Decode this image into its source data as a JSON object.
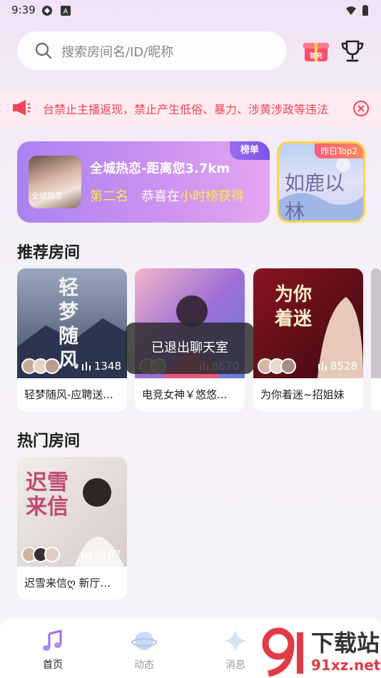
{
  "status_bar": {
    "time": "9:39"
  },
  "search": {
    "placeholder": "搜索房间名/ID/昵称"
  },
  "header_icons": {
    "recharge_label": "首充"
  },
  "notice": {
    "text": "台禁止主播返现，禁止产生低俗、暴力、涉黄涉政等违法"
  },
  "rank_banner": {
    "title": "全城热恋-距离您3.7km",
    "rank_text": "第二名",
    "congrats_prefix": "恭喜在",
    "highlight": "小时榜获得",
    "tag": "榜单",
    "avatar_caption": "全城热恋"
  },
  "top2": {
    "tag": "昨日Top2",
    "art_text": "如鹿以林"
  },
  "sections": {
    "recommended": "推荐房间",
    "hot": "热门房间"
  },
  "recommended_rooms": [
    {
      "name": "轻梦随风-应聘送...",
      "count": "1348",
      "cover_text": "轻梦随风"
    },
    {
      "name": "电竞女神￥悠悠...",
      "count": "8670",
      "cover_text": ""
    },
    {
      "name": "为你着迷~招姐妹",
      "count": "8528",
      "cover_text": "为你着迷"
    }
  ],
  "hot_rooms": [
    {
      "name": "迟雪来信ღ 新厅...",
      "count": "2107",
      "cover_text": "迟雪来信"
    }
  ],
  "toast": {
    "text": "已退出聊天室"
  },
  "tabs": [
    {
      "label": "首页",
      "active": true
    },
    {
      "label": "动态",
      "active": false
    },
    {
      "label": "消息",
      "active": false
    }
  ],
  "watermark": {
    "line1": "下载站",
    "line2": "91xz.net"
  },
  "colors": {
    "accent": "#a982f3",
    "notice": "#f0455b",
    "highlight": "#ffe64a"
  }
}
